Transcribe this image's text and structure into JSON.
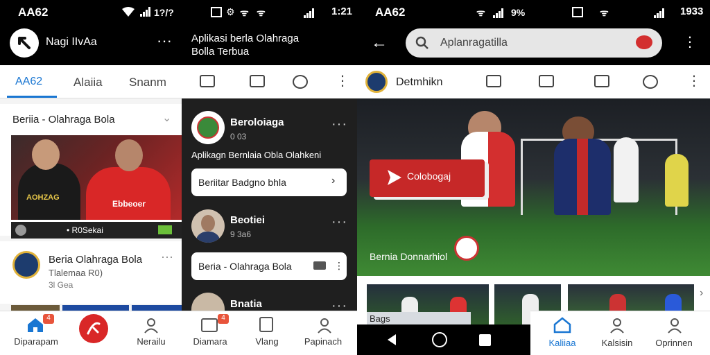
{
  "left": {
    "status_time": "AA62",
    "header_title": "Nagi IIvAa",
    "tabs": [
      "AA62",
      "Alaiia",
      "Snanm"
    ],
    "section_title": "Beriia - Olahraga Bola",
    "player_shirt": "AOHZAG",
    "player_shirt2": "Ebbeoer",
    "caption": "• R0Sekai",
    "news_title": "Beria  Olahraga Bola",
    "news_sub": "Tlalemaa R0)",
    "news_time": "3l Gea",
    "badge_count": "4",
    "nav": [
      "Diparapam",
      "Nerailu"
    ]
  },
  "middle": {
    "status_time": "1:21",
    "header_title_line1": "Aplikasi berla Olahraga",
    "header_title_line2": "Bolla Terbua",
    "item1_title": "Beroloiaga",
    "item1_sub": "0 03",
    "item1_desc": "Aplikagn Bernlaia Obla Olahkeni",
    "item1_button": "Beriitar Badgno bhla",
    "item2_title": "Beotiei",
    "item2_sub": "9 3a6",
    "item2_button": "Beria - Olahraga Bola",
    "item3_title": "Bnatia",
    "badge_count": "4",
    "nav": [
      "Diamara",
      "Vlang",
      "Papinach"
    ]
  },
  "right": {
    "status_time": "AA62",
    "status_right": "1933",
    "search_placeholder": "Aplanragatilla",
    "channel_name": "Detmhikn",
    "hero_banner": "Colobogaj",
    "hero_caption": "Bernia Donnarhiol",
    "thumb_label": "Bags",
    "nav": [
      "Kaliiaa",
      "Kalsisin",
      "Oprinnen"
    ]
  },
  "colors": {
    "accent_blue": "#1976d2",
    "brand_red": "#d32f2f",
    "dark_bg": "#1f1f1f"
  }
}
